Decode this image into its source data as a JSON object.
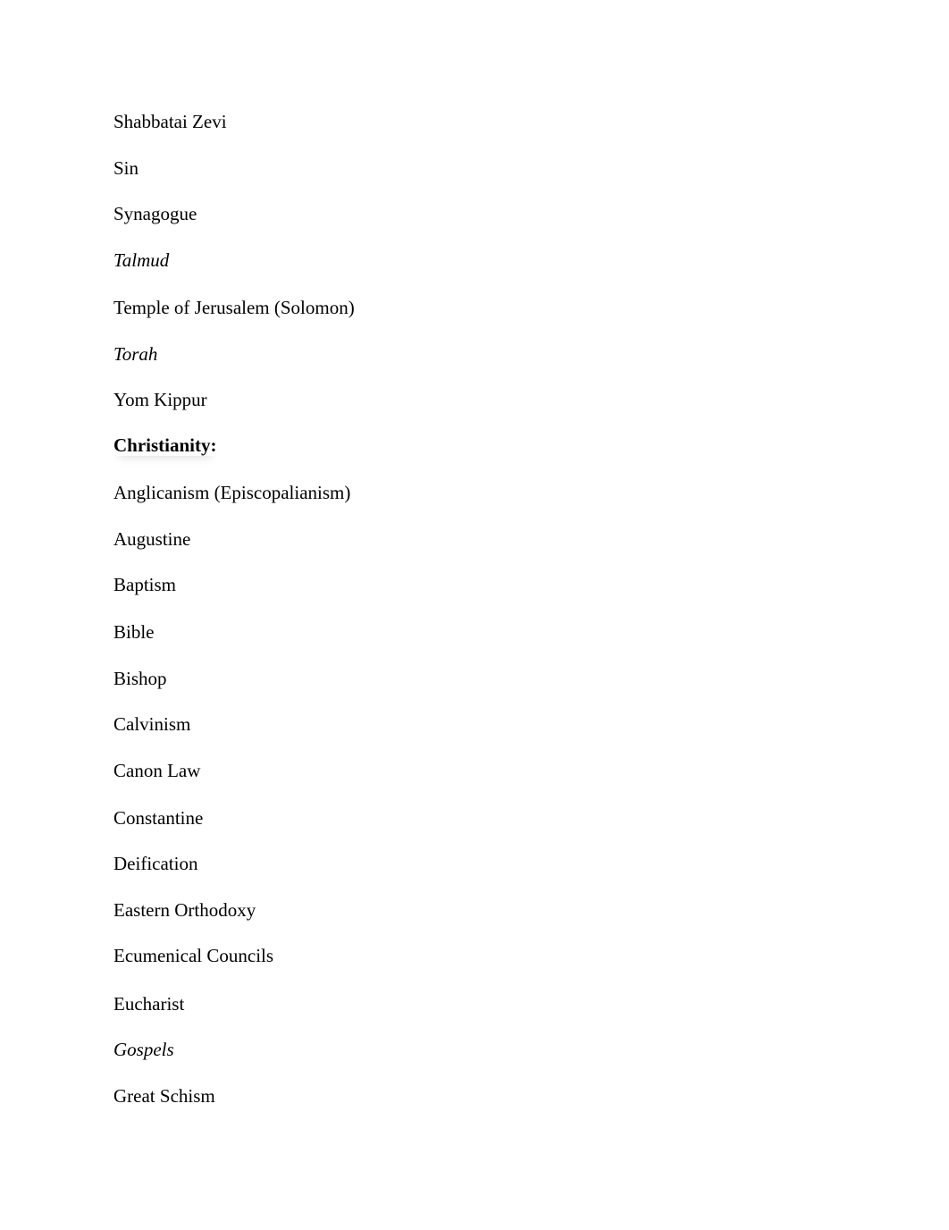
{
  "document": {
    "lines": [
      {
        "text": "Shabbatai Zevi",
        "style": "normal"
      },
      {
        "text": "Sin",
        "style": "normal"
      },
      {
        "text": "Synagogue",
        "style": "normal"
      },
      {
        "text": "Talmud",
        "style": "italic"
      },
      {
        "text": "Temple of Jerusalem (Solomon)",
        "style": "normal"
      },
      {
        "text": "Torah",
        "style": "italic"
      },
      {
        "text": "Yom Kippur",
        "style": "normal"
      },
      {
        "text": "Christianity:",
        "style": "bold"
      },
      {
        "text": "Anglicanism (Episcopalianism)",
        "style": "normal"
      },
      {
        "text": "Augustine",
        "style": "normal"
      },
      {
        "text": "Baptism",
        "style": "normal"
      },
      {
        "text": "Bible",
        "style": "normal"
      },
      {
        "text": "Bishop",
        "style": "normal"
      },
      {
        "text": "Calvinism",
        "style": "normal"
      },
      {
        "text": "Canon Law",
        "style": "normal"
      },
      {
        "text": "Constantine",
        "style": "normal"
      },
      {
        "text": "Deification",
        "style": "normal"
      },
      {
        "text": "Eastern Orthodoxy",
        "style": "normal"
      },
      {
        "text": "Ecumenical Councils",
        "style": "normal"
      },
      {
        "text": "Eucharist",
        "style": "normal"
      },
      {
        "text": "Gospels",
        "style": "italic"
      },
      {
        "text": "Great Schism",
        "style": "normal"
      }
    ]
  }
}
